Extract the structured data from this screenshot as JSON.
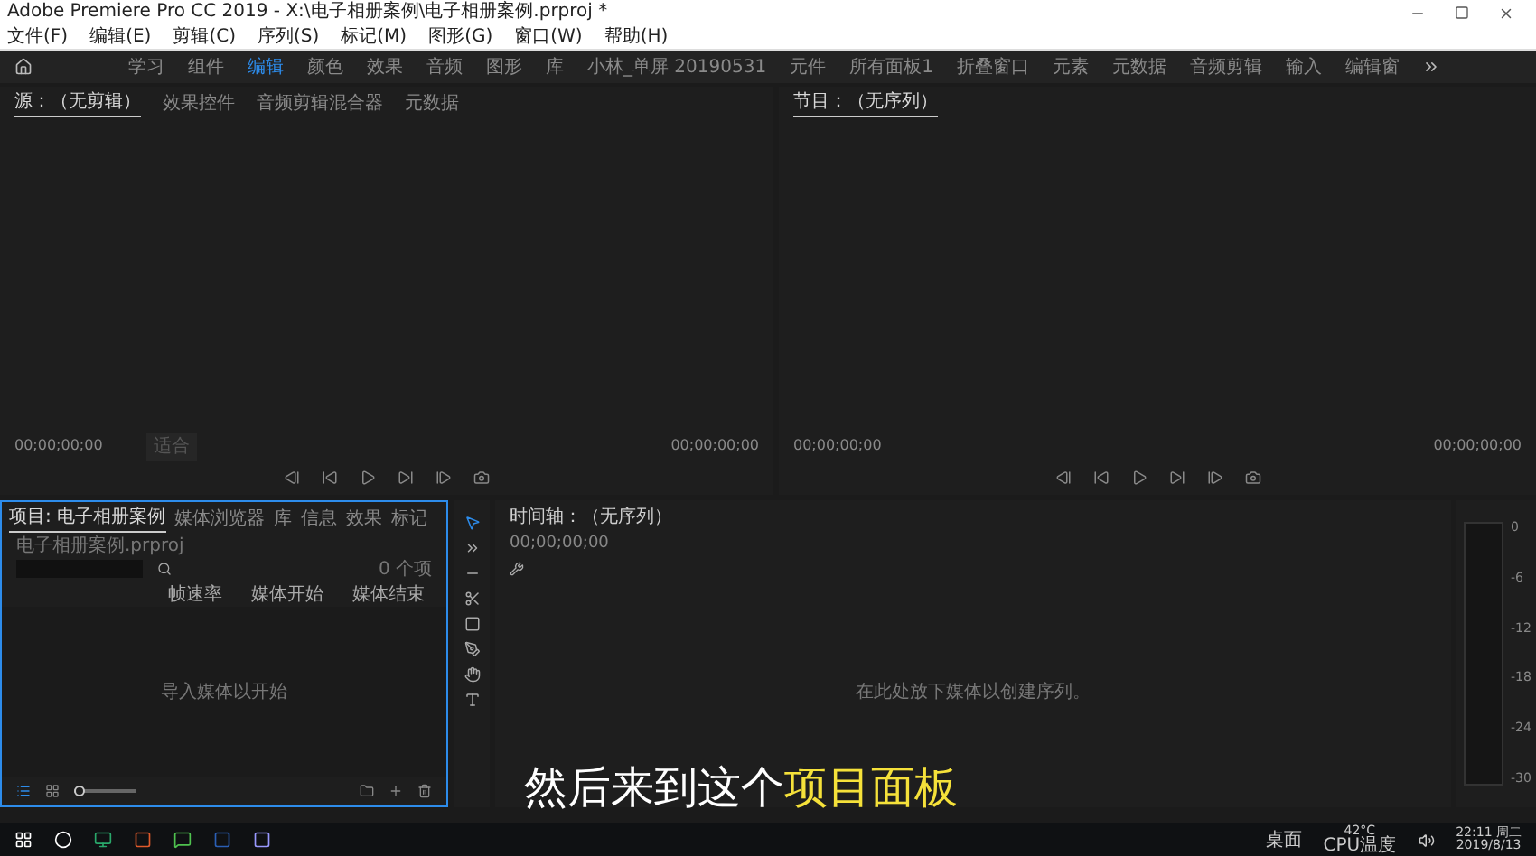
{
  "window": {
    "title": "Adobe Premiere Pro CC 2019 - X:\\电子相册案例\\电子相册案例.prproj *"
  },
  "menu": [
    "文件(F)",
    "编辑(E)",
    "剪辑(C)",
    "序列(S)",
    "标记(M)",
    "图形(G)",
    "窗口(W)",
    "帮助(H)"
  ],
  "workspaces": [
    {
      "label": "学习",
      "selected": false
    },
    {
      "label": "组件",
      "selected": false
    },
    {
      "label": "编辑",
      "selected": true
    },
    {
      "label": "颜色",
      "selected": false
    },
    {
      "label": "效果",
      "selected": false
    },
    {
      "label": "音频",
      "selected": false
    },
    {
      "label": "图形",
      "selected": false
    },
    {
      "label": "库",
      "selected": false
    },
    {
      "label": "小林_单屏 20190531",
      "selected": false
    },
    {
      "label": "元件",
      "selected": false
    },
    {
      "label": "所有面板1",
      "selected": false
    },
    {
      "label": "折叠窗口",
      "selected": false
    },
    {
      "label": "元素",
      "selected": false
    },
    {
      "label": "元数据",
      "selected": false
    },
    {
      "label": "音频剪辑",
      "selected": false
    },
    {
      "label": "输入",
      "selected": false
    },
    {
      "label": "编辑窗",
      "selected": false
    }
  ],
  "source_panel": {
    "tabs": [
      {
        "label": "源：（无剪辑）",
        "selected": true
      },
      {
        "label": "效果控件",
        "selected": false
      },
      {
        "label": "音频剪辑混合器",
        "selected": false
      },
      {
        "label": "元数据",
        "selected": false
      }
    ],
    "timecode_in": "00;00;00;00",
    "fit": "适合",
    "timecode_out": "00;00;00;00"
  },
  "program_panel": {
    "tabs": [
      {
        "label": "节目：（无序列）",
        "selected": true
      }
    ],
    "timecode_in": "00;00;00;00",
    "timecode_out": "00;00;00;00"
  },
  "project_panel": {
    "tabs": [
      {
        "label": "项目: 电子相册案例",
        "selected": true
      },
      {
        "label": "媒体浏览器",
        "selected": false
      },
      {
        "label": "库",
        "selected": false
      },
      {
        "label": "信息",
        "selected": false
      },
      {
        "label": "效果",
        "selected": false
      },
      {
        "label": "标记",
        "selected": false
      }
    ],
    "file": "电子相册案例.prproj",
    "item_count": "0 个项",
    "columns": [
      "帧速率",
      "媒体开始",
      "媒体结束"
    ],
    "empty_message": "导入媒体以开始",
    "zoom_slider": {
      "level": 0.1
    }
  },
  "timeline": {
    "tab": "时间轴：（无序列）",
    "timecode": "00;00;00;00",
    "empty_message": "在此处放下媒体以创建序列。"
  },
  "meter": {
    "ticks": [
      "0",
      "-6",
      "-12",
      "-18",
      "-24",
      "-30"
    ]
  },
  "subtitle": {
    "text": "然后来到这个",
    "highlight": "项目面板"
  },
  "taskbar": {
    "toolbar": "桌面",
    "temperature": "42°C",
    "sensor": "CPU温度",
    "time": "22:11 周二",
    "date": "2019/8/13"
  }
}
